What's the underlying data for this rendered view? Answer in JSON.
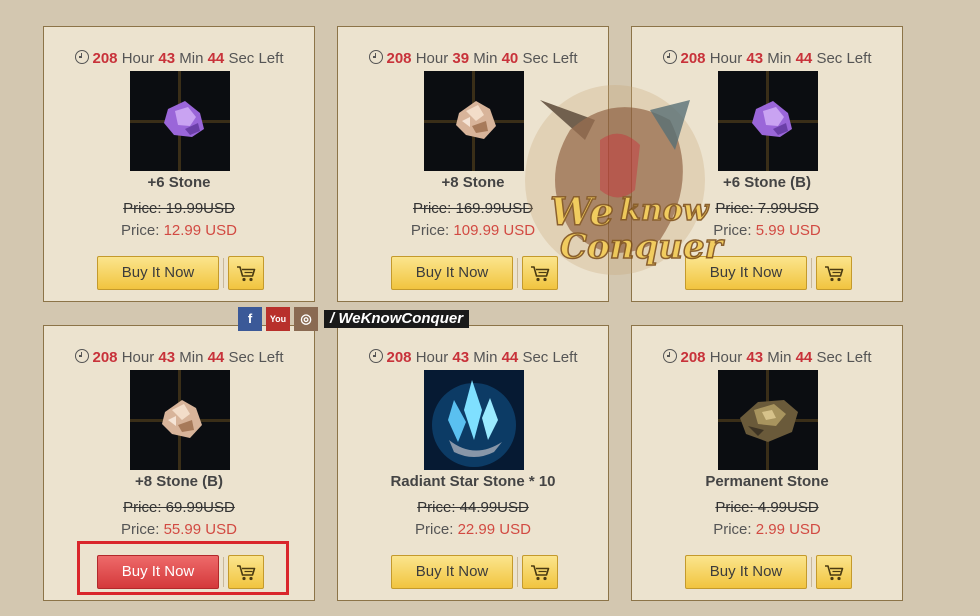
{
  "watermark": {
    "brand_text": "We Know Conquer",
    "social_handle": "/ WeKnowConquer"
  },
  "labels": {
    "hour": "Hour",
    "min": "Min",
    "sec_left": "Sec Left",
    "buy": "Buy It Now"
  },
  "products": [
    {
      "name": "+6 Stone",
      "old_price": "Price: 19.99USD",
      "price_label": "Price: ",
      "price_value": "12.99 USD",
      "timer": {
        "hours": "208",
        "minutes": "43",
        "seconds": "44"
      },
      "image": "purple-stone",
      "buy_state": "normal"
    },
    {
      "name": "+8 Stone",
      "old_price": "Price: 169.99USD",
      "price_label": "Price: ",
      "price_value": "109.99 USD",
      "timer": {
        "hours": "208",
        "minutes": "39",
        "seconds": "40"
      },
      "image": "pink-stone",
      "buy_state": "normal"
    },
    {
      "name": "+6 Stone (B)",
      "old_price": "Price: 7.99USD",
      "price_label": "Price: ",
      "price_value": "5.99 USD",
      "timer": {
        "hours": "208",
        "minutes": "43",
        "seconds": "44"
      },
      "image": "purple-stone",
      "buy_state": "normal"
    },
    {
      "name": "+8 Stone (B)",
      "old_price": "Price: 69.99USD",
      "price_label": "Price: ",
      "price_value": "55.99 USD",
      "timer": {
        "hours": "208",
        "minutes": "43",
        "seconds": "44"
      },
      "image": "pink-stone",
      "buy_state": "hover-highlighted"
    },
    {
      "name": "Radiant Star Stone * 10",
      "old_price": "Price: 44.99USD",
      "price_label": "Price: ",
      "price_value": "22.99 USD",
      "timer": {
        "hours": "208",
        "minutes": "43",
        "seconds": "44"
      },
      "image": "blue-crystal",
      "buy_state": "normal"
    },
    {
      "name": "Permanent Stone",
      "old_price": "Price: 4.99USD",
      "price_label": "Price: ",
      "price_value": "2.99 USD",
      "timer": {
        "hours": "208",
        "minutes": "43",
        "seconds": "44"
      },
      "image": "gold-stone",
      "buy_state": "normal"
    }
  ],
  "colors": {
    "accent_red": "#c8323a",
    "button_yellow": "#f1c43f",
    "button_red": "#d4393b",
    "card_bg": "#ece3cf"
  }
}
